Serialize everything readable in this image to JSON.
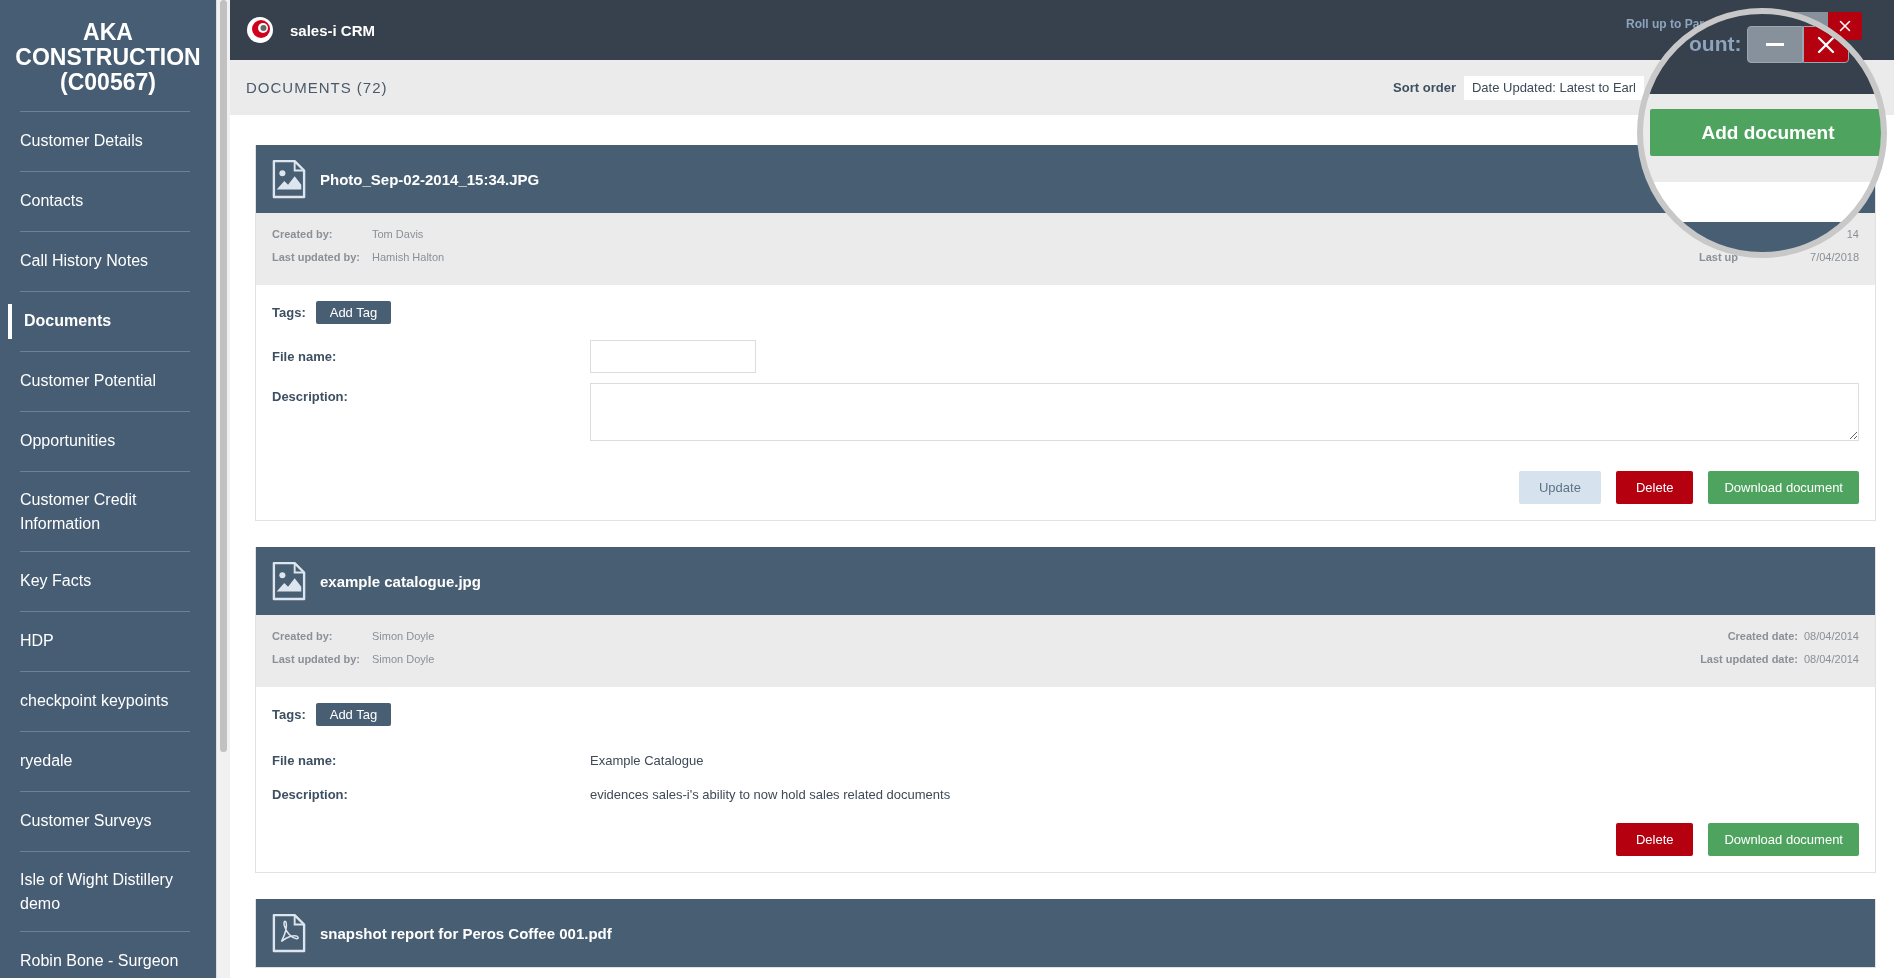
{
  "sidebar": {
    "title": "AKA CONSTRUCTION (C00567)",
    "items": [
      {
        "label": "Customer Details",
        "selected": false
      },
      {
        "label": "Contacts",
        "selected": false
      },
      {
        "label": "Call History Notes",
        "selected": false
      },
      {
        "label": "Documents",
        "selected": true
      },
      {
        "label": "Customer Potential",
        "selected": false
      },
      {
        "label": "Opportunities",
        "selected": false
      },
      {
        "label": "Customer Credit Information",
        "selected": false
      },
      {
        "label": "Key Facts",
        "selected": false
      },
      {
        "label": "HDP",
        "selected": false
      },
      {
        "label": "checkpoint keypoints",
        "selected": false
      },
      {
        "label": "ryedale",
        "selected": false
      },
      {
        "label": "Customer Surveys",
        "selected": false
      },
      {
        "label": "Isle of Wight Distillery demo",
        "selected": false
      },
      {
        "label": "Robin Bone - Surgeon",
        "selected": false
      }
    ]
  },
  "topbar": {
    "app_name": "sales-i CRM",
    "rollup_link": "Roll up to Par"
  },
  "documents": {
    "heading": "DOCUMENTS (72)",
    "sort_label": "Sort order",
    "sort_value": "Date Updated: Latest to Earl"
  },
  "magnifier": {
    "count_label": "ount:",
    "add_button": "Add document"
  },
  "cards": [
    {
      "kind": "image",
      "title": "Photo_Sep-02-2014_15:34.JPG",
      "created_by_label": "Created by:",
      "created_by": "Tom Davis",
      "updated_by_label": "Last updated by:",
      "updated_by": "Hamish Halton",
      "right_meta": [
        {
          "value": "14"
        },
        {
          "label": "Last up",
          "value": "7/04/2018",
          "obscured": true
        }
      ],
      "tags_label": "Tags:",
      "add_tag": "Add Tag",
      "file_name_label": "File name:",
      "description_label": "Description:",
      "editable": true,
      "buttons": [
        {
          "label": "Update",
          "kind": "update"
        },
        {
          "label": "Delete",
          "kind": "delete"
        },
        {
          "label": "Download document",
          "kind": "download"
        }
      ]
    },
    {
      "kind": "image",
      "title": "example catalogue.jpg",
      "created_by_label": "Created by:",
      "created_by": "Simon Doyle",
      "updated_by_label": "Last updated by:",
      "updated_by": "Simon Doyle",
      "right_meta": [
        {
          "label": "Created date:",
          "value": "08/04/2014",
          "obscured": false
        },
        {
          "label": "Last updated date:",
          "value": "08/04/2014",
          "obscured": false
        }
      ],
      "tags_label": "Tags:",
      "add_tag": "Add Tag",
      "file_name_label": "File name:",
      "file_name": "Example Catalogue",
      "description_label": "Description:",
      "description": "evidences sales-i's ability to now hold sales related documents",
      "editable": false,
      "buttons": [
        {
          "label": "Delete",
          "kind": "delete"
        },
        {
          "label": "Download document",
          "kind": "download"
        }
      ]
    },
    {
      "kind": "pdf",
      "title": "snapshot report for Peros Coffee 001.pdf"
    }
  ]
}
